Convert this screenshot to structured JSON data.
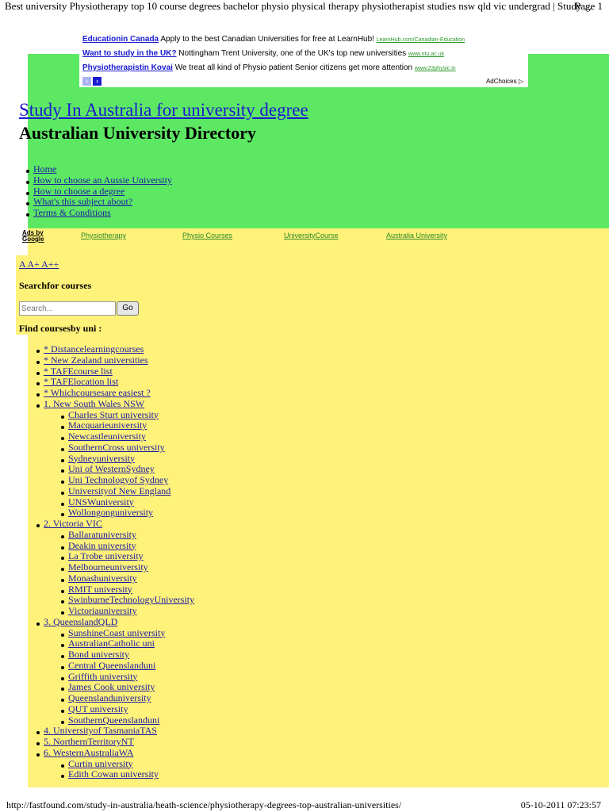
{
  "pdf": {
    "title": "Best university Physiotherapy top 10 course degrees bachelor physio physical therapy physiotherapist studies nsw qld vic undergrad | Study ...",
    "page": "Page 1",
    "url": "http://fastfound.com/study-in-australia/heath-science/physiotherapy-degrees-top-australian-universities/",
    "timestamp": "05-10-2011 07:23:57"
  },
  "ads": [
    {
      "title": "Educationin Canada",
      "text": "Apply to the best Canadian Universities for free at LearnHub!",
      "url": "LearnHub.com/Canadian-Education"
    },
    {
      "title": "Want to study in the UK?",
      "text": "Nottingham Trent University, one of the UK's top new universities",
      "url": "www.ntu.ac.uk"
    },
    {
      "title": "Physiotherapistin Kovai",
      "text": "We treat all kind of Physio patient Senior citizens get more attention",
      "url": "www.23physic.in"
    }
  ],
  "adchoices": "AdChoices ▷",
  "colors": {
    "green": "#5de864",
    "yellow": "#fff27a",
    "link": "#1a1aa6"
  },
  "header": {
    "title": "Study In Australia for university degree",
    "subtitle": "Australian University Directory"
  },
  "menu": [
    "Home",
    "How to choose an Aussie University",
    "How to choose a degree",
    "What's this subject about?",
    "Terms & Conditions"
  ],
  "adlinks": {
    "label1": "Ads by",
    "label2": "Google",
    "links": [
      "Physiotherapy",
      "Physio Courses",
      "UniversityCourse",
      "Australia University"
    ]
  },
  "sizes": "A A+ A++",
  "search": {
    "label": "Searchfor courses",
    "placeholder": "Search...",
    "button": "Go"
  },
  "find_label": "Find coursesby uni :",
  "unis": [
    {
      "label": "* Distancelearningcourses",
      "children": []
    },
    {
      "label": "* New Zealand universities",
      "children": []
    },
    {
      "label": "* TAFEcourse list",
      "children": []
    },
    {
      "label": "* TAFElocation list",
      "children": []
    },
    {
      "label": "* Whichcoursesare easiest ?",
      "children": []
    },
    {
      "label": "1. New South Wales NSW",
      "children": [
        "Charles Sturt university",
        "Macquarieuniversity",
        "Newcastleuniversity",
        "SouthernCross university",
        "Sydneyuniversity",
        "Uni of WesternSydney",
        "Uni Technologyof Sydney",
        "Universityof New England",
        "UNSWuniversity",
        "Wollongonguniversity"
      ]
    },
    {
      "label": "2. Victoria VIC",
      "children": [
        "Ballaratuniversity",
        "Deakin university",
        "La Trobe university",
        "Melbourneuniversity",
        "Monashuniversity",
        "RMIT university",
        "SwinburneTechnologyUniversity",
        "Victoriauniversity"
      ]
    },
    {
      "label": "3. QueenslandQLD",
      "children": [
        "SunshineCoast university",
        "AustralianCatholic uni",
        "Bond university",
        "Central Queenslanduni",
        "Griffith university",
        "James Cook university",
        "Queenslanduniversity",
        "QUT university",
        "SouthernQueenslanduni"
      ]
    },
    {
      "label": "4. Universityof TasmaniaTAS",
      "children": []
    },
    {
      "label": "5. NorthernTerritoryNT",
      "children": []
    },
    {
      "label": "6. WesternAustraliaWA",
      "children": [
        "Curtin university",
        "Edith Cowan university"
      ]
    }
  ]
}
